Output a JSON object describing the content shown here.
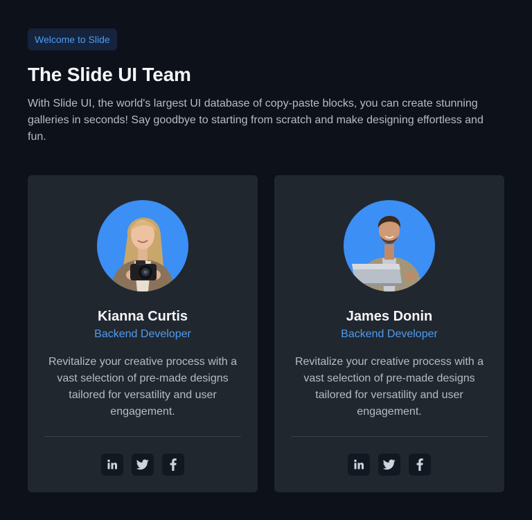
{
  "header": {
    "badge": "Welcome to Slide",
    "title": "The Slide UI Team",
    "description": "With Slide UI, the world's largest UI database of copy-paste blocks, you can create stunning galleries in seconds! Say goodbye to starting from scratch and make designing effortless and fun."
  },
  "team": [
    {
      "name": "Kianna Curtis",
      "role": "Backend Developer",
      "bio": "Revitalize your creative process with a vast selection of pre-made designs tailored for versatility and user engagement.",
      "avatar_icon": "woman-with-camera-photo",
      "socials": [
        "linkedin-icon",
        "twitter-icon",
        "facebook-icon"
      ]
    },
    {
      "name": "James Donin",
      "role": "Backend Developer",
      "bio": "Revitalize your creative process with a vast selection of pre-made designs tailored for versatility and user engagement.",
      "avatar_icon": "man-with-laptop-photo",
      "socials": [
        "linkedin-icon",
        "twitter-icon",
        "facebook-icon"
      ]
    }
  ],
  "colors": {
    "background": "#0d111a",
    "card": "#21272f",
    "accent": "#4f9cf0",
    "avatar_bg": "#3b8ff5",
    "badge_bg": "#15233c"
  }
}
